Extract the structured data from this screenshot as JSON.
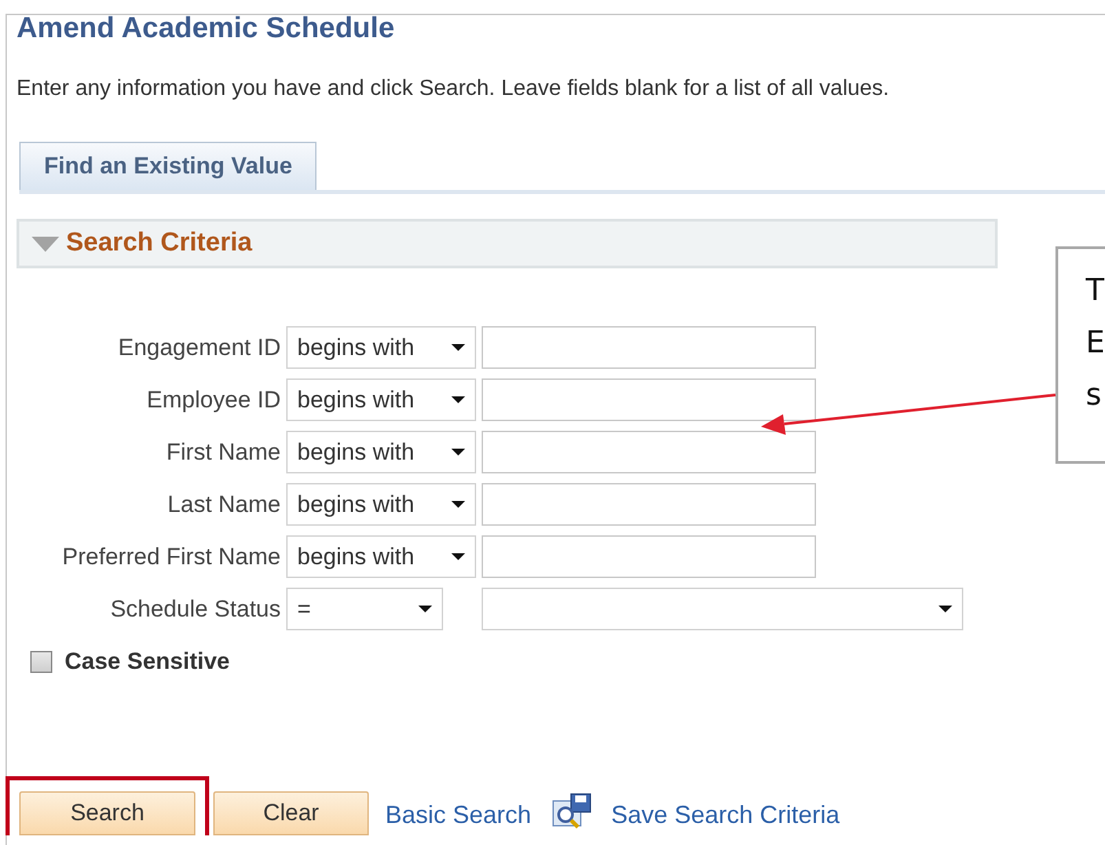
{
  "title": "Amend Academic Schedule",
  "instructions": "Enter any information you have and click Search. Leave fields blank for a list of all values.",
  "tabs": [
    {
      "label": "Find an Existing Value",
      "selected": true
    }
  ],
  "section": {
    "title": "Search Criteria",
    "expanded": true
  },
  "fields": [
    {
      "label": "Engagement ID",
      "operator": "begins with",
      "kind": "text"
    },
    {
      "label": "Employee ID",
      "operator": "begins with",
      "kind": "text"
    },
    {
      "label": "First Name",
      "operator": "begins with",
      "kind": "text"
    },
    {
      "label": "Last Name",
      "operator": "begins with",
      "kind": "text"
    },
    {
      "label": "Preferred First Name",
      "operator": "begins with",
      "kind": "text"
    },
    {
      "label": "Schedule Status",
      "operator": "=",
      "kind": "dropdown"
    }
  ],
  "case_sensitive": {
    "label": "Case Sensitive",
    "checked": false
  },
  "buttons": [
    {
      "label": "Search",
      "highlighted": true
    },
    {
      "label": "Clear",
      "highlighted": false
    }
  ],
  "links": [
    {
      "label": "Basic Search",
      "kind": "plain"
    },
    {
      "label": "Save Search Criteria",
      "kind": "save"
    }
  ],
  "callout": {
    "lines": [
      "T",
      "E",
      "s"
    ]
  }
}
